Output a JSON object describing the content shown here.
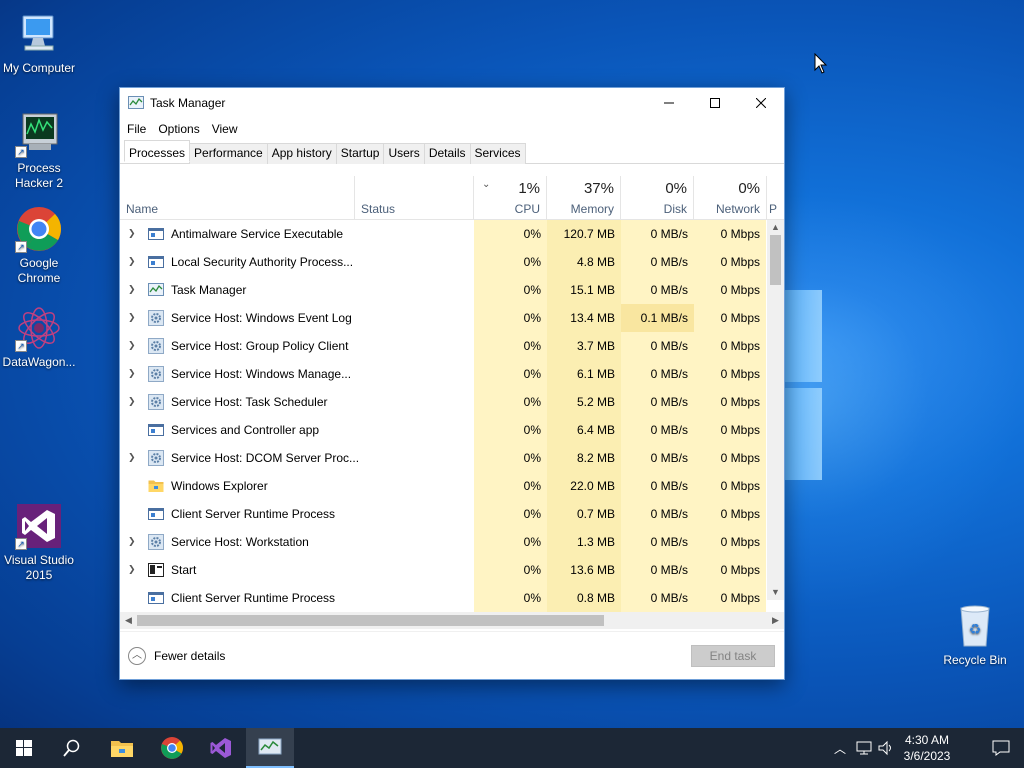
{
  "desktop": {
    "icons": [
      {
        "label": "My Computer"
      },
      {
        "label": "Process Hacker 2"
      },
      {
        "label": "Google Chrome"
      },
      {
        "label": "DataWagon..."
      },
      {
        "label": "Visual Studio 2015"
      },
      {
        "label": "Recycle Bin"
      }
    ]
  },
  "window": {
    "title": "Task Manager",
    "menu": [
      "File",
      "Options",
      "View"
    ],
    "tabs": [
      "Processes",
      "Performance",
      "App history",
      "Startup",
      "Users",
      "Details",
      "Services"
    ],
    "active_tab": "Processes",
    "columns": {
      "name": "Name",
      "status": "Status",
      "cpu": {
        "pct": "1%",
        "label": "CPU"
      },
      "memory": {
        "pct": "37%",
        "label": "Memory"
      },
      "disk": {
        "pct": "0%",
        "label": "Disk"
      },
      "network": {
        "pct": "0%",
        "label": "Network"
      },
      "extra": "P"
    },
    "processes": [
      {
        "name": "Antimalware Service Executable",
        "expandable": true,
        "icon": "app-window-icon",
        "cpu": "0%",
        "memory": "120.7 MB",
        "disk": "0 MB/s",
        "network": "0 Mbps"
      },
      {
        "name": "Local Security Authority Process...",
        "expandable": true,
        "icon": "app-window-icon",
        "cpu": "0%",
        "memory": "4.8 MB",
        "disk": "0 MB/s",
        "network": "0 Mbps"
      },
      {
        "name": "Task Manager",
        "expandable": true,
        "icon": "task-manager-icon",
        "cpu": "0%",
        "memory": "15.1 MB",
        "disk": "0 MB/s",
        "network": "0 Mbps"
      },
      {
        "name": "Service Host: Windows Event Log",
        "expandable": true,
        "icon": "gear-icon",
        "cpu": "0%",
        "memory": "13.4 MB",
        "disk": "0.1 MB/s",
        "network": "0 Mbps"
      },
      {
        "name": "Service Host: Group Policy Client",
        "expandable": true,
        "icon": "gear-icon",
        "cpu": "0%",
        "memory": "3.7 MB",
        "disk": "0 MB/s",
        "network": "0 Mbps"
      },
      {
        "name": "Service Host: Windows Manage...",
        "expandable": true,
        "icon": "gear-icon",
        "cpu": "0%",
        "memory": "6.1 MB",
        "disk": "0 MB/s",
        "network": "0 Mbps"
      },
      {
        "name": "Service Host: Task Scheduler",
        "expandable": true,
        "icon": "gear-icon",
        "cpu": "0%",
        "memory": "5.2 MB",
        "disk": "0 MB/s",
        "network": "0 Mbps"
      },
      {
        "name": "Services and Controller app",
        "expandable": false,
        "icon": "app-window-icon",
        "cpu": "0%",
        "memory": "6.4 MB",
        "disk": "0 MB/s",
        "network": "0 Mbps"
      },
      {
        "name": "Service Host: DCOM Server Proc...",
        "expandable": true,
        "icon": "gear-icon",
        "cpu": "0%",
        "memory": "8.2 MB",
        "disk": "0 MB/s",
        "network": "0 Mbps"
      },
      {
        "name": "Windows Explorer",
        "expandable": false,
        "icon": "folder-icon",
        "cpu": "0%",
        "memory": "22.0 MB",
        "disk": "0 MB/s",
        "network": "0 Mbps"
      },
      {
        "name": "Client Server Runtime Process",
        "expandable": false,
        "icon": "app-window-icon",
        "cpu": "0%",
        "memory": "0.7 MB",
        "disk": "0 MB/s",
        "network": "0 Mbps"
      },
      {
        "name": "Service Host: Workstation",
        "expandable": true,
        "icon": "gear-icon",
        "cpu": "0%",
        "memory": "1.3 MB",
        "disk": "0 MB/s",
        "network": "0 Mbps"
      },
      {
        "name": "Start",
        "expandable": true,
        "icon": "start-icon",
        "cpu": "0%",
        "memory": "13.6 MB",
        "disk": "0 MB/s",
        "network": "0 Mbps"
      },
      {
        "name": "Client Server Runtime Process",
        "expandable": false,
        "icon": "app-window-icon",
        "cpu": "0%",
        "memory": "0.8 MB",
        "disk": "0 MB/s",
        "network": "0 Mbps"
      }
    ],
    "footer": {
      "fewer_details": "Fewer details",
      "end_task": "End task"
    }
  },
  "taskbar": {
    "time": "4:30 AM",
    "date": "3/6/2023"
  },
  "colors": {
    "cpu_bg": "#fff4c4",
    "mem_bg": "#fbeeb2",
    "disk_highlight": "#f9e6a0",
    "taskbar": "#1c2736"
  }
}
